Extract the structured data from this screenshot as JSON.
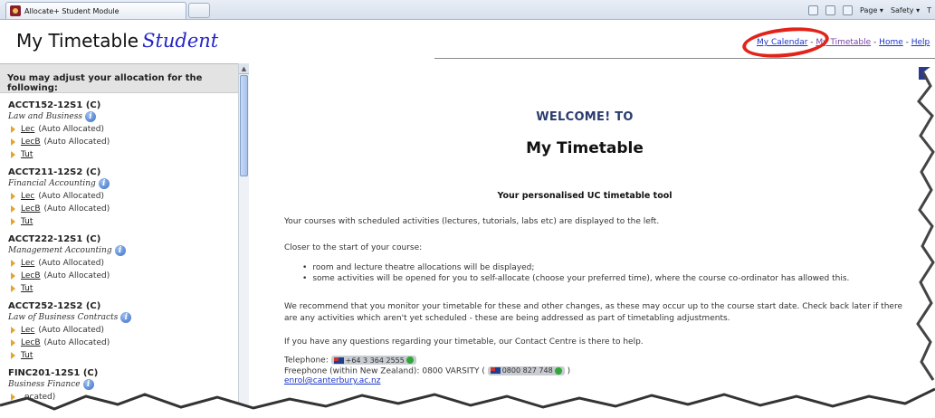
{
  "browser": {
    "tab_title": "Allocate+ Student Module",
    "cmdbar": [
      "Page ▾",
      "Safety ▾",
      "T"
    ]
  },
  "header": {
    "app_name": "My Timetable",
    "app_sub": "Student",
    "links": [
      {
        "label": "My Calendar",
        "sep": " - "
      },
      {
        "label": "My Timetable",
        "sep": " - "
      },
      {
        "label": "Home",
        "sep": " - "
      },
      {
        "label": "Help",
        "sep": ""
      }
    ]
  },
  "sidebar": {
    "banner": "You may adjust your allocation for the following:",
    "courses": [
      {
        "code": "ACCT152-12S1 (C)",
        "name": "Law and Business",
        "activities": [
          {
            "link": "Lec",
            "status": "(Auto Allocated)"
          },
          {
            "link": "LecB",
            "status": "(Auto Allocated)"
          },
          {
            "link": "Tut",
            "status": ""
          }
        ]
      },
      {
        "code": "ACCT211-12S2 (C)",
        "name": "Financial Accounting",
        "activities": [
          {
            "link": "Lec",
            "status": "(Auto Allocated)"
          },
          {
            "link": "LecB",
            "status": "(Auto Allocated)"
          },
          {
            "link": "Tut",
            "status": ""
          }
        ]
      },
      {
        "code": "ACCT222-12S1 (C)",
        "name": "Management Accounting",
        "activities": [
          {
            "link": "Lec",
            "status": "(Auto Allocated)"
          },
          {
            "link": "LecB",
            "status": "(Auto Allocated)"
          },
          {
            "link": "Tut",
            "status": ""
          }
        ]
      },
      {
        "code": "ACCT252-12S2 (C)",
        "name": "Law of Business Contracts",
        "activities": [
          {
            "link": "Lec",
            "status": "(Auto Allocated)"
          },
          {
            "link": "LecB",
            "status": "(Auto Allocated)"
          },
          {
            "link": "Tut",
            "status": ""
          }
        ]
      },
      {
        "code": "FINC201-12S1 (C)",
        "name": "Business Finance",
        "activities": [
          {
            "link": "",
            "status": "ocated)"
          }
        ]
      }
    ],
    "info_glyph": "i"
  },
  "main": {
    "welcome": "WELCOME! TO",
    "title": "My Timetable",
    "tagline": "Your personalised UC timetable tool",
    "p1": "Your courses with scheduled activities (lectures, tutorials, labs etc) are displayed to the left.",
    "p2": "Closer to the start of your course:",
    "bullets": [
      "room and lecture theatre allocations will be displayed;",
      "some activities will be opened for you to self-allocate (choose your preferred time), where the course co-ordinator has allowed this."
    ],
    "p3": "We recommend that you monitor your timetable for these and other changes, as these may occur up to the course start date. Check back later if there are any activities which aren't yet scheduled - these are being addressed as part of timetabling adjustments.",
    "p4": "If you have any questions regarding your timetable, our Contact Centre is there to help.",
    "contact": {
      "telephone_label": "Telephone:",
      "telephone": "+64 3 364 2555",
      "freephone_label": "Freephone (within New Zealand): 0800 VARSITY (",
      "freephone": "0800 827 748",
      "freephone_close": ")",
      "email": "enrol@canterbury.ac.nz"
    }
  },
  "colors": {
    "link": "#1a35c9",
    "visited_link": "#7a3fa6",
    "highlight_circle": "#e2231a",
    "welcome": "#2a3b6e",
    "subtitle": "#2424c8"
  }
}
